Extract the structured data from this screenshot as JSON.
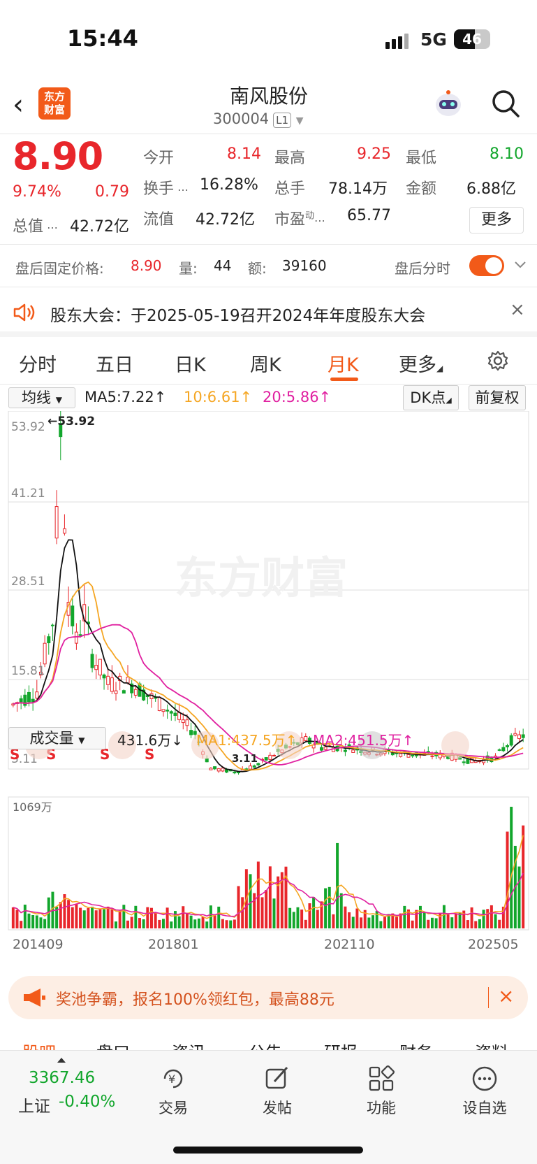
{
  "status": {
    "time": "15:44",
    "network": "5G",
    "battery": "46"
  },
  "nav": {
    "logo_line1": "东方",
    "logo_line2": "财富",
    "title": "南风股份",
    "code": "300004",
    "level": "L1"
  },
  "quote": {
    "price": "8.90",
    "change_pct": "9.74%",
    "change": "0.79",
    "open_label": "今开",
    "open": "8.14",
    "high_label": "最高",
    "high": "9.25",
    "low_label": "最低",
    "low": "8.10",
    "turnover_label": "换手",
    "turnover": "16.28%",
    "volume_label": "总手",
    "volume": "78.14万",
    "amount_label": "金额",
    "amount": "6.88亿",
    "mktcap_label": "总值",
    "mktcap": "42.72亿",
    "float_label": "流值",
    "float": "42.72亿",
    "pe_label": "市盈",
    "pe_sup": "动",
    "pe": "65.77",
    "more": "更多"
  },
  "afterhours": {
    "label": "盘后固定价格:",
    "price": "8.90",
    "vol_label": "量:",
    "vol": "44",
    "amt_label": "额:",
    "amt": "39160",
    "toggle_label": "盘后分时"
  },
  "notice": {
    "text": "股东大会：于2025-05-19召开2024年年度股东大会"
  },
  "tabs": [
    "分时",
    "五日",
    "日K",
    "周K",
    "月K",
    "更多"
  ],
  "active_tab": "月K",
  "ma": {
    "selector": "均线",
    "ma5": "MA5:7.22↑",
    "ma10": "10:6.61↑",
    "ma20": "20:5.86↑",
    "dk": "DK点",
    "fq": "前复权"
  },
  "kline": {
    "y_labels": [
      "53.92",
      "41.21",
      "28.51",
      "15.81",
      "3.11"
    ],
    "max_label": "←53.92",
    "min_label": "3.11",
    "watermark": "东方财富",
    "signals": [
      "S",
      "S",
      "S",
      "S"
    ]
  },
  "volbar": {
    "selector": "成交量",
    "current": "431.6万↓",
    "ma1": "MA1:437.5万↑",
    "ma2": "MA2:451.5万↑",
    "ymax": "1069万"
  },
  "x_labels": [
    "201409",
    "201801",
    "202110",
    "202505"
  ],
  "colors": {
    "up": "#e8262b",
    "down": "#12a62c",
    "accent": "#f25a19",
    "ma5": "#111111",
    "ma10": "#f5a623",
    "ma20": "#e020a0"
  },
  "promo": {
    "text": "奖池争霸，报名100%领红包，最高88元"
  },
  "peek_tabs": [
    "股吧",
    "盘口",
    "资讯",
    "公告",
    "研报",
    "财务",
    "资料"
  ],
  "bottom": {
    "index_value": "3367.46",
    "index_name": "上证",
    "index_change": "-0.40%",
    "trade": "交易",
    "post": "发帖",
    "func": "功能",
    "watch": "设自选"
  },
  "chart_data": {
    "type": "candlestick",
    "price_range": [
      3.11,
      53.92
    ],
    "volume_range": [
      0,
      1069
    ],
    "series": [
      {
        "name": "MA5",
        "value": 7.22
      },
      {
        "name": "10",
        "value": 6.61
      },
      {
        "name": "20",
        "value": 5.86
      }
    ],
    "x_ticks": [
      "201409",
      "201801",
      "202110",
      "202505"
    ]
  }
}
